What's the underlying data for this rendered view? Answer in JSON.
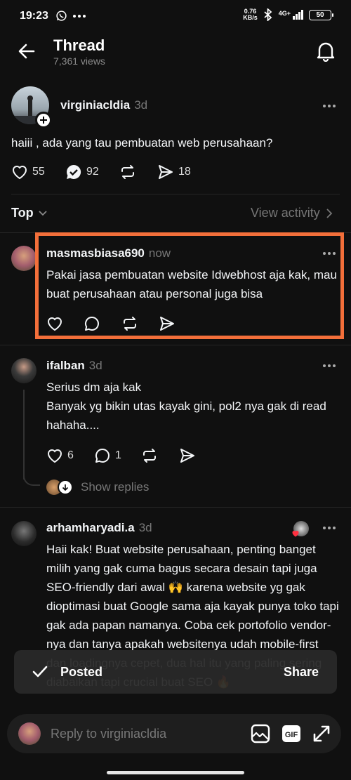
{
  "status_bar": {
    "time": "19:23",
    "net_speed_value": "0.76",
    "net_speed_unit": "KB/s",
    "network": "4G+",
    "battery": "50"
  },
  "header": {
    "title": "Thread",
    "views": "7,361 views"
  },
  "main_post": {
    "username": "virginiacldia",
    "time": "3d",
    "text": "haiii , ada yang tau pembuatan web perusahaan?",
    "likes": "55",
    "comments": "92",
    "shares": "18"
  },
  "sort_bar": {
    "sort_label": "Top",
    "view_activity": "View activity"
  },
  "replies": [
    {
      "username": "masmasbiasa690",
      "time": "now",
      "text": "Pakai jasa pembuatan website Idwebhost aja kak, mau buat perusahaan atau personal juga bisa",
      "highlight_color": "#f36f3a"
    },
    {
      "username": "ifalban",
      "time": "3d",
      "text_line1": "Serius dm aja kak",
      "text_line2": "Banyak yg bikin utas kayak gini, pol2 nya gak di read hahaha....",
      "likes": "6",
      "comments": "1",
      "show_replies": "Show replies"
    },
    {
      "username": "arhamharyadi.a",
      "time": "3d",
      "text": "Haii kak! Buat website perusahaan, penting banget milih yang gak cuma bagus secara desain tapi juga SEO-friendly dari awal 🙌 karena website yg gak dioptimasi buat Google sama aja kayak punya toko tapi gak ada papan namanya. Coba cek portofolio vendor-nya dan tanya apakah websitenya udah mobile-first dan loadingnya cepet, dua hal itu yang paling sering diabaikan tapi crucial buat SEO 🔥"
    }
  ],
  "toast": {
    "label": "Posted",
    "action": "Share"
  },
  "reply_bar": {
    "placeholder": "Reply to virginiacldia"
  },
  "icons": {
    "back": "arrow-left",
    "bell": "bell",
    "more": "three-dots",
    "like": "heart",
    "comment": "speech-bubble",
    "repost": "repost-arrows",
    "share": "send-arrow",
    "image": "image",
    "gif": "gif",
    "expand": "expand-arrows",
    "check": "checkmark"
  },
  "colors": {
    "background": "#101010",
    "highlight": "#f36f3a",
    "text": "#f3f5f7",
    "muted": "#777777"
  }
}
